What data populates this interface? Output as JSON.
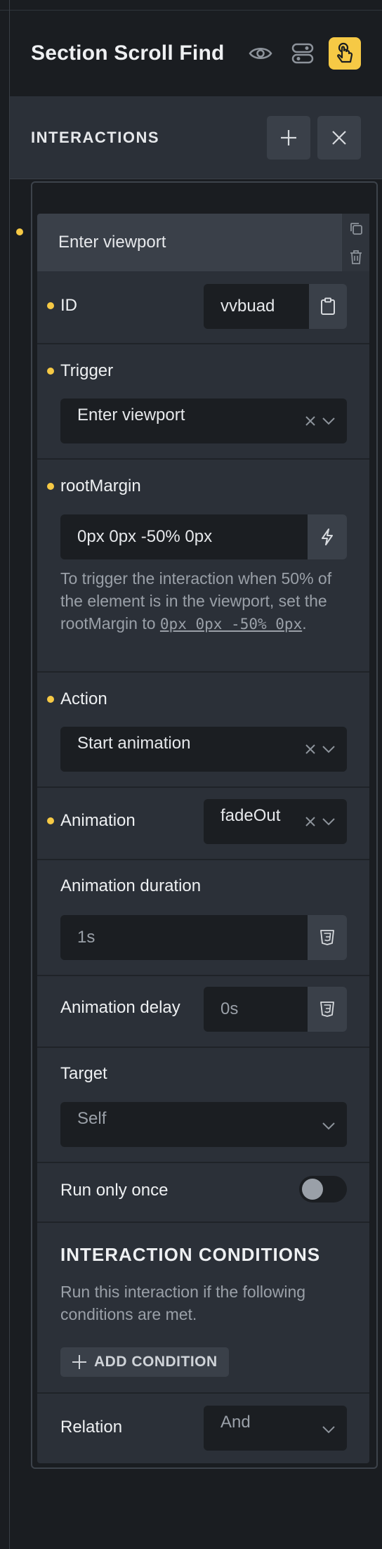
{
  "header": {
    "title": "Section Scroll Find"
  },
  "section": {
    "title": "INTERACTIONS"
  },
  "interaction": {
    "header_label": "Enter viewport",
    "id": {
      "label": "ID",
      "value": "vvbuad"
    },
    "trigger": {
      "label": "Trigger",
      "value": "Enter viewport"
    },
    "root_margin": {
      "label": "rootMargin",
      "value": "0px 0px -50% 0px",
      "hint_prefix": "To trigger the interaction when 50% of the element is in the viewport, set the rootMargin to",
      "hint_code": "0px 0px -50% 0px",
      "hint_suffix": "."
    },
    "action": {
      "label": "Action",
      "value": "Start animation"
    },
    "animation": {
      "label": "Animation",
      "value": "fadeOut"
    },
    "animation_duration": {
      "label": "Animation duration",
      "placeholder": "1s"
    },
    "animation_delay": {
      "label": "Animation delay",
      "placeholder": "0s"
    },
    "target": {
      "label": "Target",
      "placeholder": "Self"
    },
    "run_only_once": {
      "label": "Run only once",
      "enabled": false
    },
    "conditions": {
      "title": "INTERACTION CONDITIONS",
      "description": "Run this interaction if the following conditions are met.",
      "add_label": "ADD CONDITION"
    },
    "relation": {
      "label": "Relation",
      "value": "And"
    }
  },
  "colors": {
    "accent": "#f6c945",
    "panel": "#2b3038",
    "field": "#1b1e22",
    "background": "#1a1d21"
  },
  "icons": [
    "eye-icon",
    "toggles-icon",
    "hand-pointer-icon",
    "plus-icon",
    "close-icon",
    "clone-icon",
    "trash-icon",
    "clipboard-icon",
    "clear-icon",
    "chevron-down-icon",
    "bolt-icon",
    "css3-icon"
  ]
}
